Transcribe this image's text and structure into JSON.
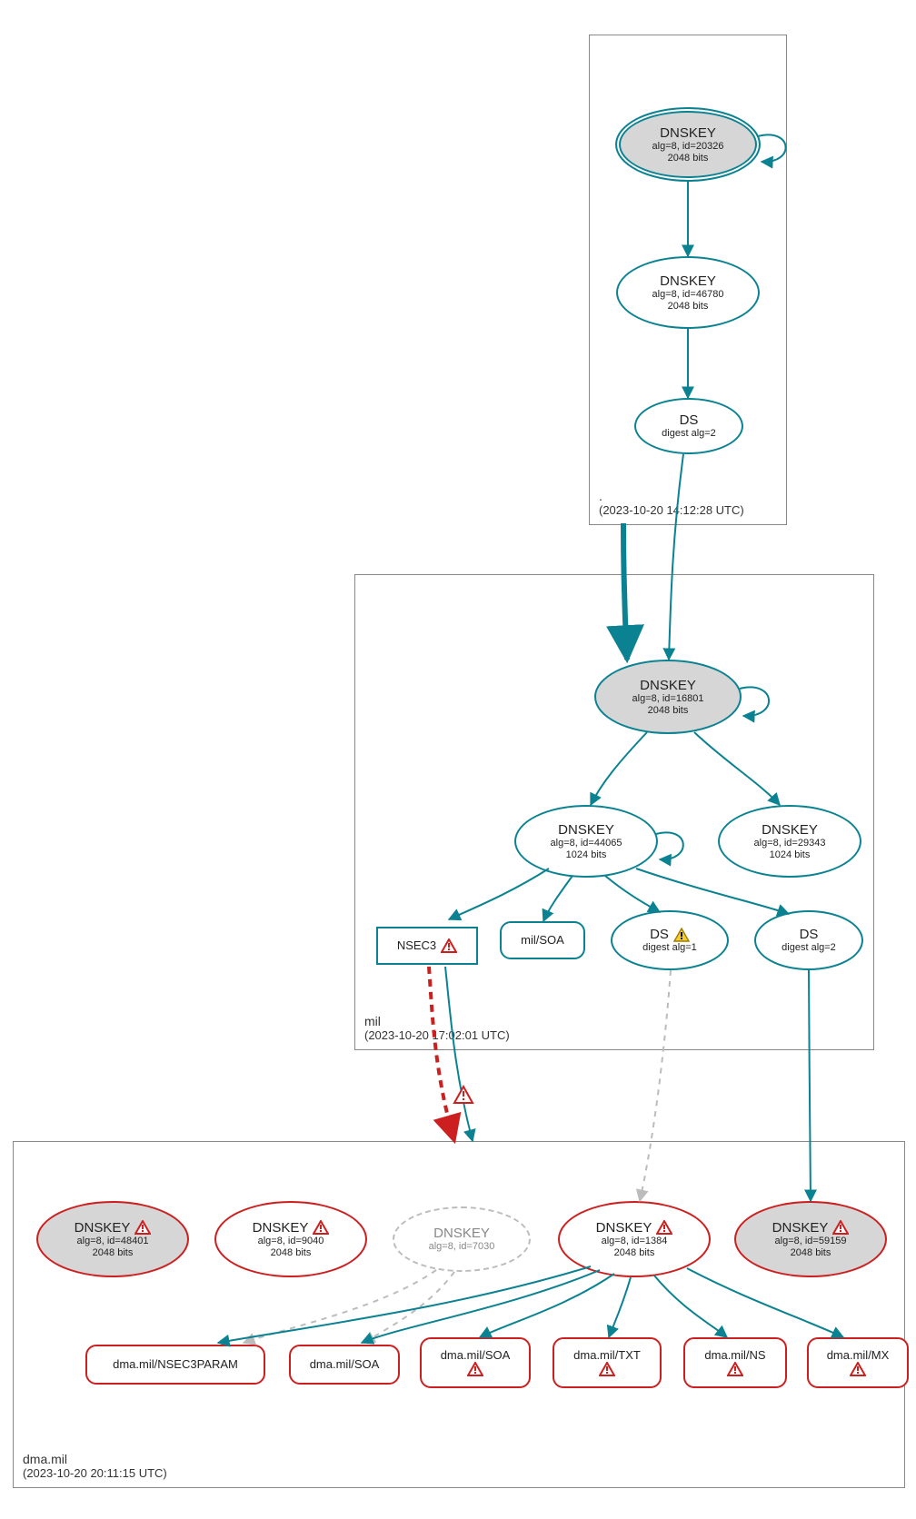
{
  "colors": {
    "teal": "#0b8291",
    "red": "#cc2020",
    "grey": "#bcbcbc",
    "yellow": "#f4cf2e",
    "node_fill_grey": "#d6d6d6"
  },
  "zones": {
    "root": {
      "name": ".",
      "timestamp": "(2023-10-20 14:12:28 UTC)"
    },
    "mil": {
      "name": "mil",
      "timestamp": "(2023-10-20 17:02:01 UTC)"
    },
    "dma": {
      "name": "dma.mil",
      "timestamp": "(2023-10-20 20:11:15 UTC)"
    }
  },
  "nodes": {
    "root_ksk": {
      "title": "DNSKEY",
      "sub1": "alg=8, id=20326",
      "sub2": "2048 bits"
    },
    "root_zsk": {
      "title": "DNSKEY",
      "sub1": "alg=8, id=46780",
      "sub2": "2048 bits"
    },
    "root_ds": {
      "title": "DS",
      "sub1": "digest alg=2"
    },
    "mil_ksk": {
      "title": "DNSKEY",
      "sub1": "alg=8, id=16801",
      "sub2": "2048 bits"
    },
    "mil_zsk": {
      "title": "DNSKEY",
      "sub1": "alg=8, id=44065",
      "sub2": "1024 bits"
    },
    "mil_zsk2": {
      "title": "DNSKEY",
      "sub1": "alg=8, id=29343",
      "sub2": "1024 bits"
    },
    "mil_nsec3": {
      "title": "NSEC3"
    },
    "mil_soa": {
      "title": "mil/SOA"
    },
    "mil_ds1": {
      "title": "DS",
      "sub1": "digest alg=1"
    },
    "mil_ds2": {
      "title": "DS",
      "sub1": "digest alg=2"
    },
    "dma_k48401": {
      "title": "DNSKEY",
      "sub1": "alg=8, id=48401",
      "sub2": "2048 bits"
    },
    "dma_k9040": {
      "title": "DNSKEY",
      "sub1": "alg=8, id=9040",
      "sub2": "2048 bits"
    },
    "dma_k7030": {
      "title": "DNSKEY",
      "sub1": "alg=8, id=7030"
    },
    "dma_k1384": {
      "title": "DNSKEY",
      "sub1": "alg=8, id=1384",
      "sub2": "2048 bits"
    },
    "dma_k59159": {
      "title": "DNSKEY",
      "sub1": "alg=8, id=59159",
      "sub2": "2048 bits"
    },
    "dma_nsec3param": {
      "title": "dma.mil/NSEC3PARAM"
    },
    "dma_soa_a": {
      "title": "dma.mil/SOA"
    },
    "dma_soa_b": {
      "title": "dma.mil/SOA"
    },
    "dma_txt": {
      "title": "dma.mil/TXT"
    },
    "dma_ns": {
      "title": "dma.mil/NS"
    },
    "dma_mx": {
      "title": "dma.mil/MX"
    }
  }
}
